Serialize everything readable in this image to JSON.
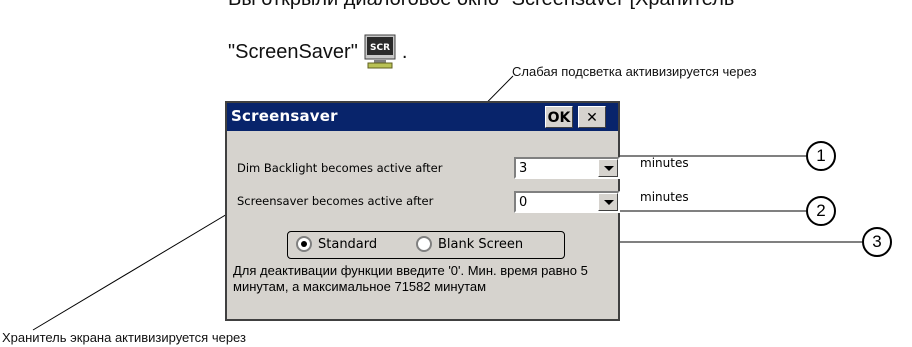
{
  "intro": {
    "line1": "Вы открыли диалоговое окно \"Screensaver [Хранитель",
    "line2": "\"ScreenSaver\"",
    "icon_name": "screensaver-control-panel-icon"
  },
  "callouts": {
    "dim_backlight": "Слабая подсветка активизируется через",
    "screensaver": "Хранитель экрана активизируется через",
    "numbers": [
      "1",
      "2",
      "3"
    ]
  },
  "dialog": {
    "title": "Screensaver",
    "ok_label": "OK",
    "close_label": "✕",
    "dim_row": {
      "label": "Dim Backlight becomes active after",
      "value": "3",
      "unit": "minutes"
    },
    "saver_row": {
      "label": "Screensaver becomes active after",
      "value": "0",
      "unit": "minutes"
    },
    "radio": {
      "standard": {
        "label": "Standard",
        "selected": true
      },
      "blank": {
        "label": "Blank Screen",
        "selected": false
      }
    },
    "note": "Для деактивации функции введите '0'. Мин. время равно 5 минутам, а максимальное 71582 минутам"
  },
  "colors": {
    "titlebar": "#08246b",
    "dialog_bg": "#d6d3ce"
  }
}
